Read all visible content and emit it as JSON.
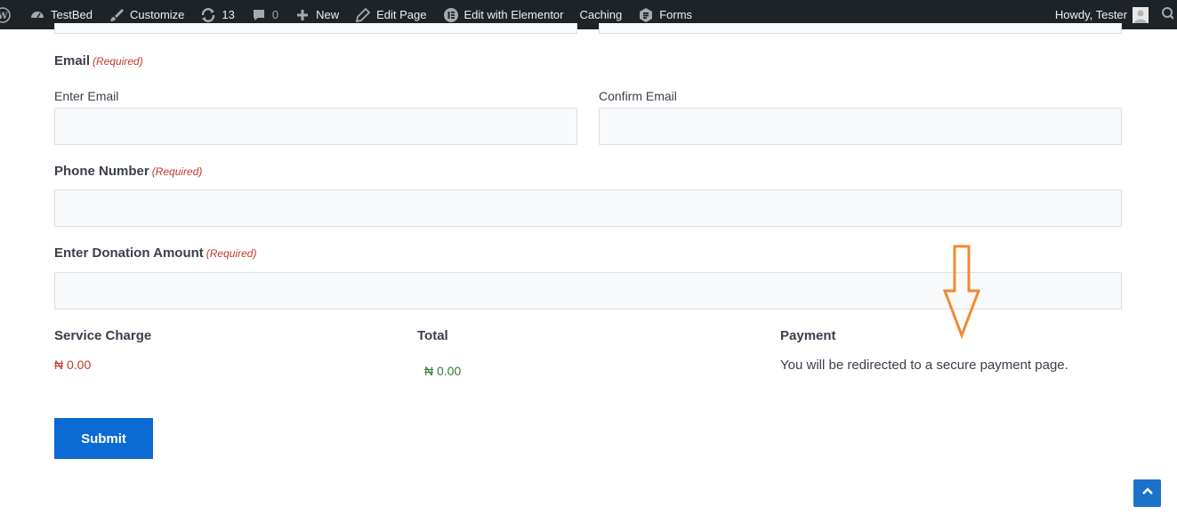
{
  "adminbar": {
    "site_name": "TestBed",
    "customize": "Customize",
    "updates_count": "13",
    "comments_count": "0",
    "new_label": "New",
    "edit_page": "Edit Page",
    "elementor": "Edit with Elementor",
    "caching": "Caching",
    "forms": "Forms",
    "howdy": "Howdy, Tester"
  },
  "form": {
    "email": {
      "label": "Email",
      "required": "(Required)",
      "enter_label": "Enter Email",
      "confirm_label": "Confirm Email"
    },
    "phone": {
      "label": "Phone Number",
      "required": "(Required)"
    },
    "donation": {
      "label": "Enter Donation Amount",
      "required": "(Required)"
    },
    "service_charge": {
      "label": "Service Charge",
      "value": "₦ 0.00"
    },
    "total": {
      "label": "Total",
      "value": "₦ 0.00"
    },
    "payment": {
      "label": "Payment",
      "text": "You will be redirected to a secure payment page."
    },
    "submit_label": "Submit"
  },
  "colors": {
    "adminbar_bg": "#1d2327",
    "required": "#c0392b",
    "total": "#2e7d32",
    "button": "#0b6ad3",
    "annotation_arrow": "#f28a2e"
  },
  "icons": [
    "wordpress-icon",
    "dashboard-icon",
    "brush-icon",
    "updates-icon",
    "comment-icon",
    "plus-icon",
    "pencil-icon",
    "elementor-icon",
    "forms-icon",
    "search-icon",
    "chevron-up-icon",
    "down-arrow-annotation"
  ]
}
